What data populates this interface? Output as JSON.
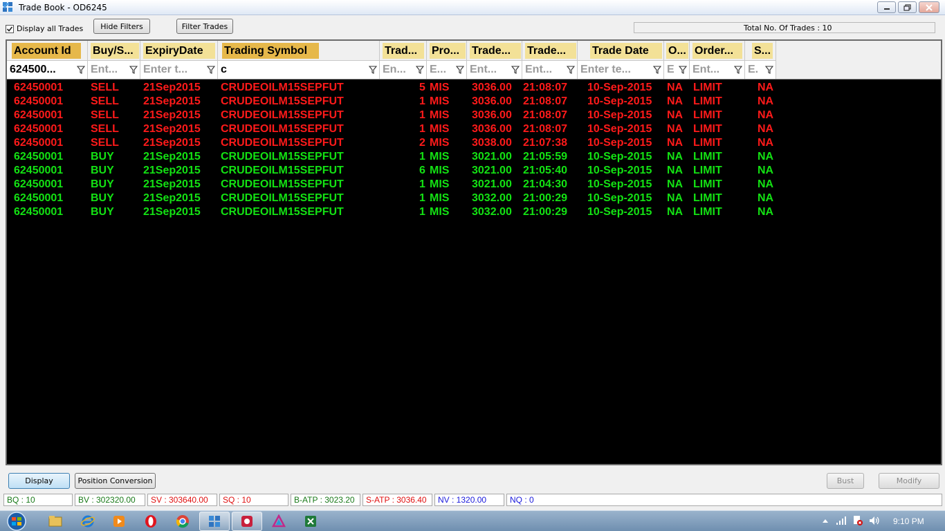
{
  "window": {
    "title": "Trade Book - OD6245"
  },
  "toolbar": {
    "display_all_label": "Display all Trades",
    "display_all_checked": true,
    "hide_filters_label": "Hide Filters",
    "filter_trades_label": "Filter Trades",
    "total_trades_text": "Total No. Of Trades : 10"
  },
  "grid": {
    "columns": [
      {
        "header": "Account Id",
        "filter": "624500...",
        "filter_is_placeholder": false,
        "highlight": "gold"
      },
      {
        "header": "Buy/S...",
        "filter": "Ent...",
        "filter_is_placeholder": true,
        "highlight": "light"
      },
      {
        "header": "ExpiryDate",
        "filter": "Enter t...",
        "filter_is_placeholder": true,
        "highlight": "light"
      },
      {
        "header": "Trading Symbol",
        "filter": "c",
        "filter_is_placeholder": false,
        "highlight": "gold"
      },
      {
        "header": "Trad...",
        "filter": "En...",
        "filter_is_placeholder": true,
        "highlight": "light"
      },
      {
        "header": "Pro...",
        "filter": "E...",
        "filter_is_placeholder": true,
        "highlight": "light"
      },
      {
        "header": "Trade...",
        "filter": "Ent...",
        "filter_is_placeholder": true,
        "highlight": "light"
      },
      {
        "header": "Trade...",
        "filter": "Ent...",
        "filter_is_placeholder": true,
        "highlight": "light"
      },
      {
        "header": "Trade Date",
        "filter": "Enter te...",
        "filter_is_placeholder": true,
        "highlight": "light"
      },
      {
        "header": "O...",
        "filter": "E",
        "filter_is_placeholder": true,
        "highlight": "light"
      },
      {
        "header": "Order...",
        "filter": "Ent...",
        "filter_is_placeholder": true,
        "highlight": "light"
      },
      {
        "header": "S...",
        "filter": "E.",
        "filter_is_placeholder": true,
        "highlight": "light"
      }
    ],
    "rows": [
      {
        "side": "sell",
        "account": "62450001",
        "buy_sell": "SELL",
        "expiry": "21Sep2015",
        "symbol": "CRUDEOILM15SEPFUT",
        "qty": "5",
        "product": "MIS",
        "price": "3036.00",
        "time": "21:08:07",
        "date": "10-Sep-2015",
        "o": "NA",
        "order_type": "LIMIT",
        "s": "NA"
      },
      {
        "side": "sell",
        "account": "62450001",
        "buy_sell": "SELL",
        "expiry": "21Sep2015",
        "symbol": "CRUDEOILM15SEPFUT",
        "qty": "1",
        "product": "MIS",
        "price": "3036.00",
        "time": "21:08:07",
        "date": "10-Sep-2015",
        "o": "NA",
        "order_type": "LIMIT",
        "s": "NA"
      },
      {
        "side": "sell",
        "account": "62450001",
        "buy_sell": "SELL",
        "expiry": "21Sep2015",
        "symbol": "CRUDEOILM15SEPFUT",
        "qty": "1",
        "product": "MIS",
        "price": "3036.00",
        "time": "21:08:07",
        "date": "10-Sep-2015",
        "o": "NA",
        "order_type": "LIMIT",
        "s": "NA"
      },
      {
        "side": "sell",
        "account": "62450001",
        "buy_sell": "SELL",
        "expiry": "21Sep2015",
        "symbol": "CRUDEOILM15SEPFUT",
        "qty": "1",
        "product": "MIS",
        "price": "3036.00",
        "time": "21:08:07",
        "date": "10-Sep-2015",
        "o": "NA",
        "order_type": "LIMIT",
        "s": "NA"
      },
      {
        "side": "sell",
        "account": "62450001",
        "buy_sell": "SELL",
        "expiry": "21Sep2015",
        "symbol": "CRUDEOILM15SEPFUT",
        "qty": "2",
        "product": "MIS",
        "price": "3038.00",
        "time": "21:07:38",
        "date": "10-Sep-2015",
        "o": "NA",
        "order_type": "LIMIT",
        "s": "NA"
      },
      {
        "side": "buy",
        "account": "62450001",
        "buy_sell": "BUY",
        "expiry": "21Sep2015",
        "symbol": "CRUDEOILM15SEPFUT",
        "qty": "1",
        "product": "MIS",
        "price": "3021.00",
        "time": "21:05:59",
        "date": "10-Sep-2015",
        "o": "NA",
        "order_type": "LIMIT",
        "s": "NA"
      },
      {
        "side": "buy",
        "account": "62450001",
        "buy_sell": "BUY",
        "expiry": "21Sep2015",
        "symbol": "CRUDEOILM15SEPFUT",
        "qty": "6",
        "product": "MIS",
        "price": "3021.00",
        "time": "21:05:40",
        "date": "10-Sep-2015",
        "o": "NA",
        "order_type": "LIMIT",
        "s": "NA"
      },
      {
        "side": "buy",
        "account": "62450001",
        "buy_sell": "BUY",
        "expiry": "21Sep2015",
        "symbol": "CRUDEOILM15SEPFUT",
        "qty": "1",
        "product": "MIS",
        "price": "3021.00",
        "time": "21:04:30",
        "date": "10-Sep-2015",
        "o": "NA",
        "order_type": "LIMIT",
        "s": "NA"
      },
      {
        "side": "buy",
        "account": "62450001",
        "buy_sell": "BUY",
        "expiry": "21Sep2015",
        "symbol": "CRUDEOILM15SEPFUT",
        "qty": "1",
        "product": "MIS",
        "price": "3032.00",
        "time": "21:00:29",
        "date": "10-Sep-2015",
        "o": "NA",
        "order_type": "LIMIT",
        "s": "NA"
      },
      {
        "side": "buy",
        "account": "62450001",
        "buy_sell": "BUY",
        "expiry": "21Sep2015",
        "symbol": "CRUDEOILM15SEPFUT",
        "qty": "1",
        "product": "MIS",
        "price": "3032.00",
        "time": "21:00:29",
        "date": "10-Sep-2015",
        "o": "NA",
        "order_type": "LIMIT",
        "s": "NA"
      }
    ]
  },
  "actions": {
    "display_label": "Display",
    "position_conversion_label": "Position Conversion",
    "bust_label": "Bust",
    "modify_label": "Modify"
  },
  "status": {
    "bq": "BQ : 10",
    "bv": "BV : 302320.00",
    "sv": "SV : 303640.00",
    "sq": "SQ : 10",
    "batp": "B-ATP : 3023.20",
    "satp": "S-ATP : 3036.40",
    "nv": "NV : 1320.00",
    "nq": "NQ : 0"
  },
  "colors": {
    "sell": "#ff1a1a",
    "buy": "#13e213",
    "grid_bg": "#000000",
    "header_gold": "#e6b84a",
    "header_light": "#f3e197",
    "status_green": "#1a7a1a",
    "status_red": "#e01010",
    "status_blue": "#1a1adc"
  },
  "taskbar": {
    "apps": [
      "file-explorer-icon",
      "internet-explorer-icon",
      "media-player-icon",
      "opera-icon",
      "chrome-icon",
      "trade-app-icon",
      "red-app-icon",
      "triangle-app-icon",
      "excel-icon"
    ],
    "clock": "9:10 PM"
  }
}
